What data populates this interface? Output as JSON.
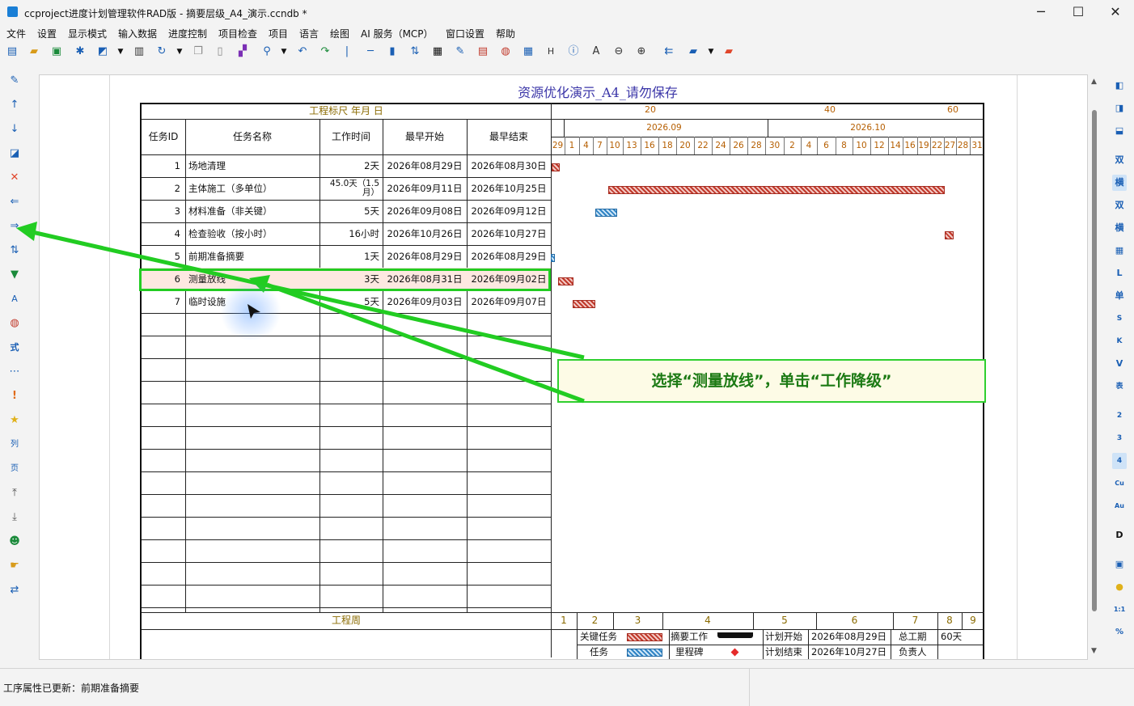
{
  "window": {
    "title": "ccproject进度计划管理软件RAD版 - 摘要层级_A4_演示.ccndb *",
    "minimize": "─",
    "maximize": "☐",
    "close": "✕"
  },
  "menu": [
    "文件",
    "设置",
    "显示模式",
    "输入数据",
    "进度控制",
    "项目检查",
    "项目",
    "语言",
    "绘图",
    "AI 服务（MCP）",
    "窗口设置",
    "帮助"
  ],
  "doc": {
    "title": "资源优化演示_A4_请勿保存"
  },
  "header": {
    "scale": "工程标尺 年月 日",
    "cols": [
      "任务ID",
      "任务名称",
      "工作时间",
      "最早开始",
      "最早结束"
    ]
  },
  "timeline": {
    "top": [
      "20",
      "40",
      "60"
    ],
    "months": [
      "2026.09",
      "2026.10"
    ],
    "days": [
      "29",
      "1",
      "4",
      "7",
      "10",
      "13",
      "16",
      "18",
      "20",
      "22",
      "24",
      "26",
      "28",
      "30",
      "2",
      "4",
      "6",
      "8",
      "10",
      "12",
      "14",
      "16",
      "19",
      "22",
      "27",
      "28",
      "31"
    ]
  },
  "tasks": [
    {
      "id": "1",
      "name": "场地清理",
      "dur": "2天",
      "start": "2026年08月29日",
      "end": "2026年08月30日"
    },
    {
      "id": "2",
      "name": "主体施工（多单位）",
      "dur": "45.0天（1.5月）",
      "start": "2026年09月11日",
      "end": "2026年10月25日"
    },
    {
      "id": "3",
      "name": "材料准备（非关键）",
      "dur": "5天",
      "start": "2026年09月08日",
      "end": "2026年09月12日"
    },
    {
      "id": "4",
      "name": "检查验收（按小时）",
      "dur": "16小时",
      "start": "2026年10月26日",
      "end": "2026年10月27日"
    },
    {
      "id": "5",
      "name": "前期准备摘要",
      "dur": "1天",
      "start": "2026年08月29日",
      "end": "2026年08月29日"
    },
    {
      "id": "6",
      "name": "测量放线",
      "dur": "3天",
      "start": "2026年08月31日",
      "end": "2026年09月02日"
    },
    {
      "id": "7",
      "name": "临时设施",
      "dur": "5天",
      "start": "2026年09月03日",
      "end": "2026年09月07日"
    }
  ],
  "footer": {
    "week_label": "工程周",
    "weeks": [
      "1",
      "2",
      "3",
      "4",
      "5",
      "6",
      "7",
      "8",
      "9"
    ],
    "legend": {
      "critical": "关键任务",
      "summary": "摘要工作",
      "task": "任务",
      "milestone": "里程碑"
    },
    "plan_start_label": "计划开始",
    "plan_start": "2026年08月29日",
    "plan_end_label": "计划结束",
    "plan_end": "2026年10月27日",
    "total_label": "总工期",
    "total": "60天",
    "owner_label": "负责人"
  },
  "callout": "选择“测量放线”，单击“工作降级”",
  "status": "工序属性已更新：前期准备摘要",
  "colors": {
    "critical": "#c0392b",
    "normal": "#2f84c5",
    "callout_border": "#2fcf2f",
    "title": "#3b36a8"
  }
}
